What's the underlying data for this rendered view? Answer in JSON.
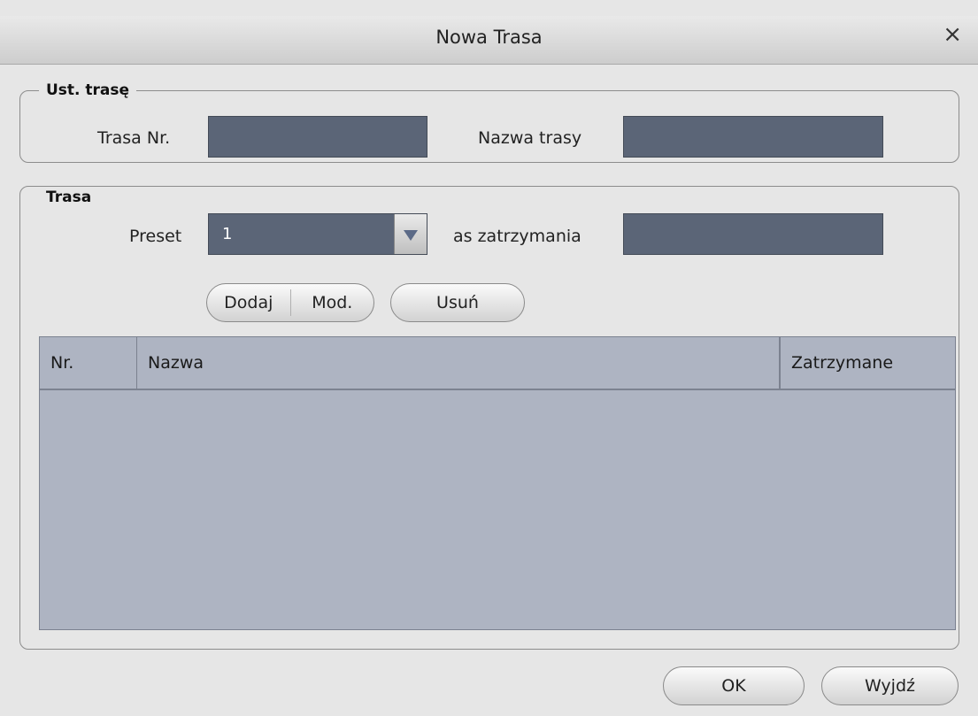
{
  "window": {
    "title": "Nowa Trasa",
    "close_glyph": "×"
  },
  "route_settings": {
    "legend": "Ust. trasę",
    "route_no_label": "Trasa Nr.",
    "route_no_value": "",
    "route_name_label": "Nazwa trasy",
    "route_name_value": ""
  },
  "route": {
    "legend": "Trasa",
    "preset_label": "Preset",
    "preset_value": "1",
    "dwell_label": "as zatrzymania",
    "dwell_value": "",
    "buttons": {
      "add": "Dodaj",
      "modify": "Mod.",
      "delete": "Usuń"
    },
    "table": {
      "columns": [
        "Nr.",
        "Nazwa",
        "Zatrzymane"
      ],
      "rows": []
    }
  },
  "footer": {
    "ok": "OK",
    "exit": "Wyjdź"
  },
  "colors": {
    "field": "#5b6577",
    "table": "#aeb4c2",
    "dialog": "#e6e6e6"
  }
}
